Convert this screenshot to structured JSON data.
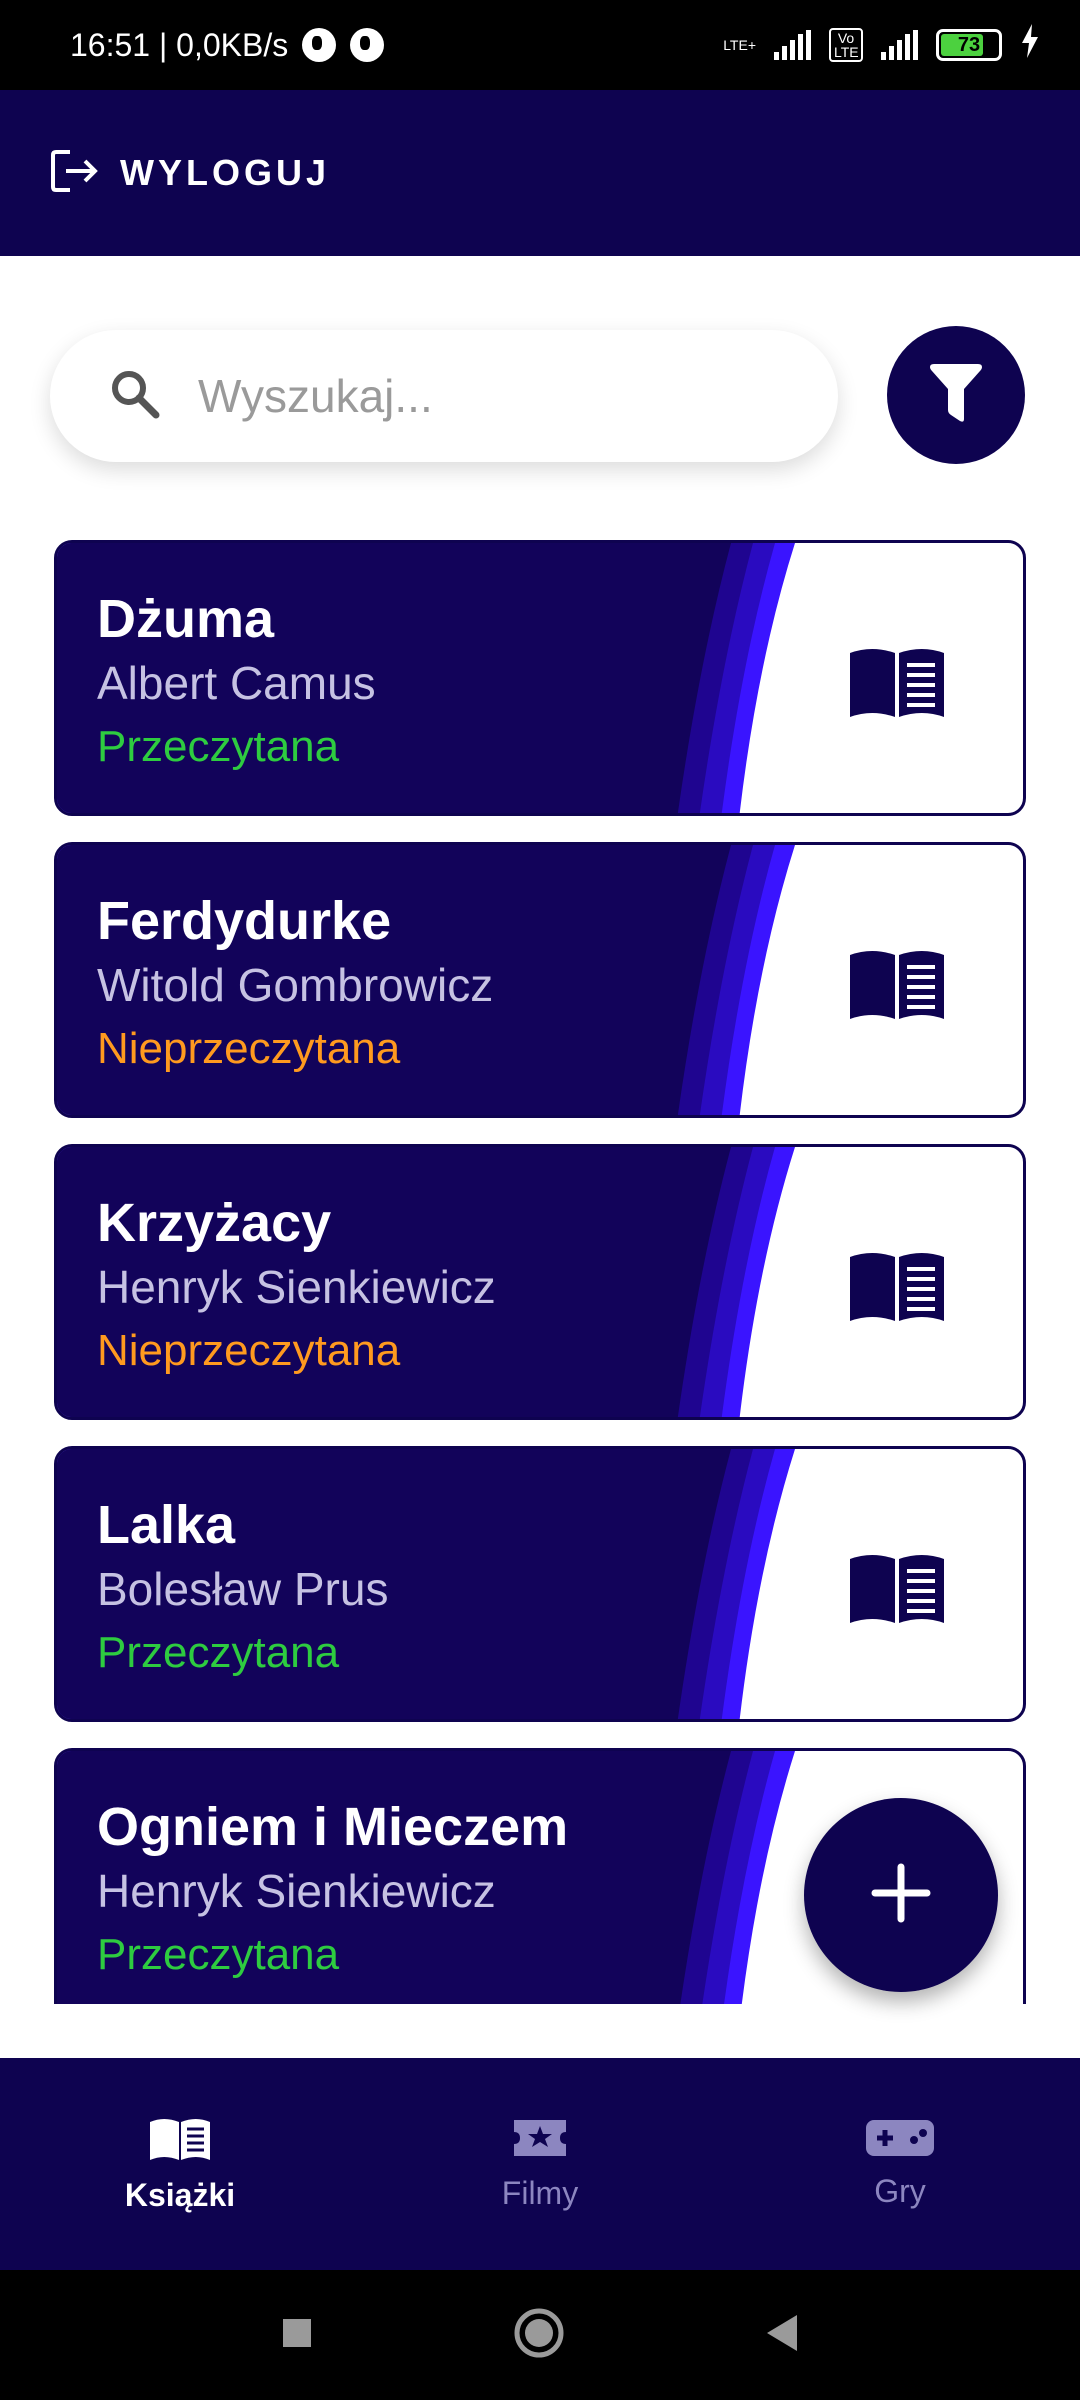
{
  "status_bar": {
    "time_speed": "16:51 | 0,0KB/s",
    "lte_label": "LTE+",
    "volte_label": "Vo LTE",
    "battery": "73"
  },
  "topbar": {
    "logout_label": "WYLOGUJ"
  },
  "search": {
    "placeholder": "Wyszukaj..."
  },
  "items": [
    {
      "title": "Dżuma",
      "author": "Albert Camus",
      "status": "Przeczytana",
      "status_color": "#2ecc40"
    },
    {
      "title": "Ferdydurke",
      "author": "Witold Gombrowicz",
      "status": "Nieprzeczytana",
      "status_color": "#ff9a1f"
    },
    {
      "title": "Krzyżacy",
      "author": "Henryk Sienkiewicz",
      "status": "Nieprzeczytana",
      "status_color": "#ff9a1f"
    },
    {
      "title": "Lalka",
      "author": "Bolesław Prus",
      "status": "Przeczytana",
      "status_color": "#2ecc40"
    },
    {
      "title": "Ogniem i Mieczem",
      "author": "Henryk Sienkiewicz",
      "status": "Przeczytana",
      "status_color": "#2ecc40"
    }
  ],
  "nav": [
    {
      "label": "Książki",
      "icon": "book-icon",
      "active": true
    },
    {
      "label": "Filmy",
      "icon": "movie-ticket-icon",
      "active": false
    },
    {
      "label": "Gry",
      "icon": "gamepad-icon",
      "active": false
    }
  ],
  "colors": {
    "primary": "#0e0350",
    "accent": "#3a14ff",
    "read": "#2ecc40",
    "unread": "#ff9a1f"
  }
}
